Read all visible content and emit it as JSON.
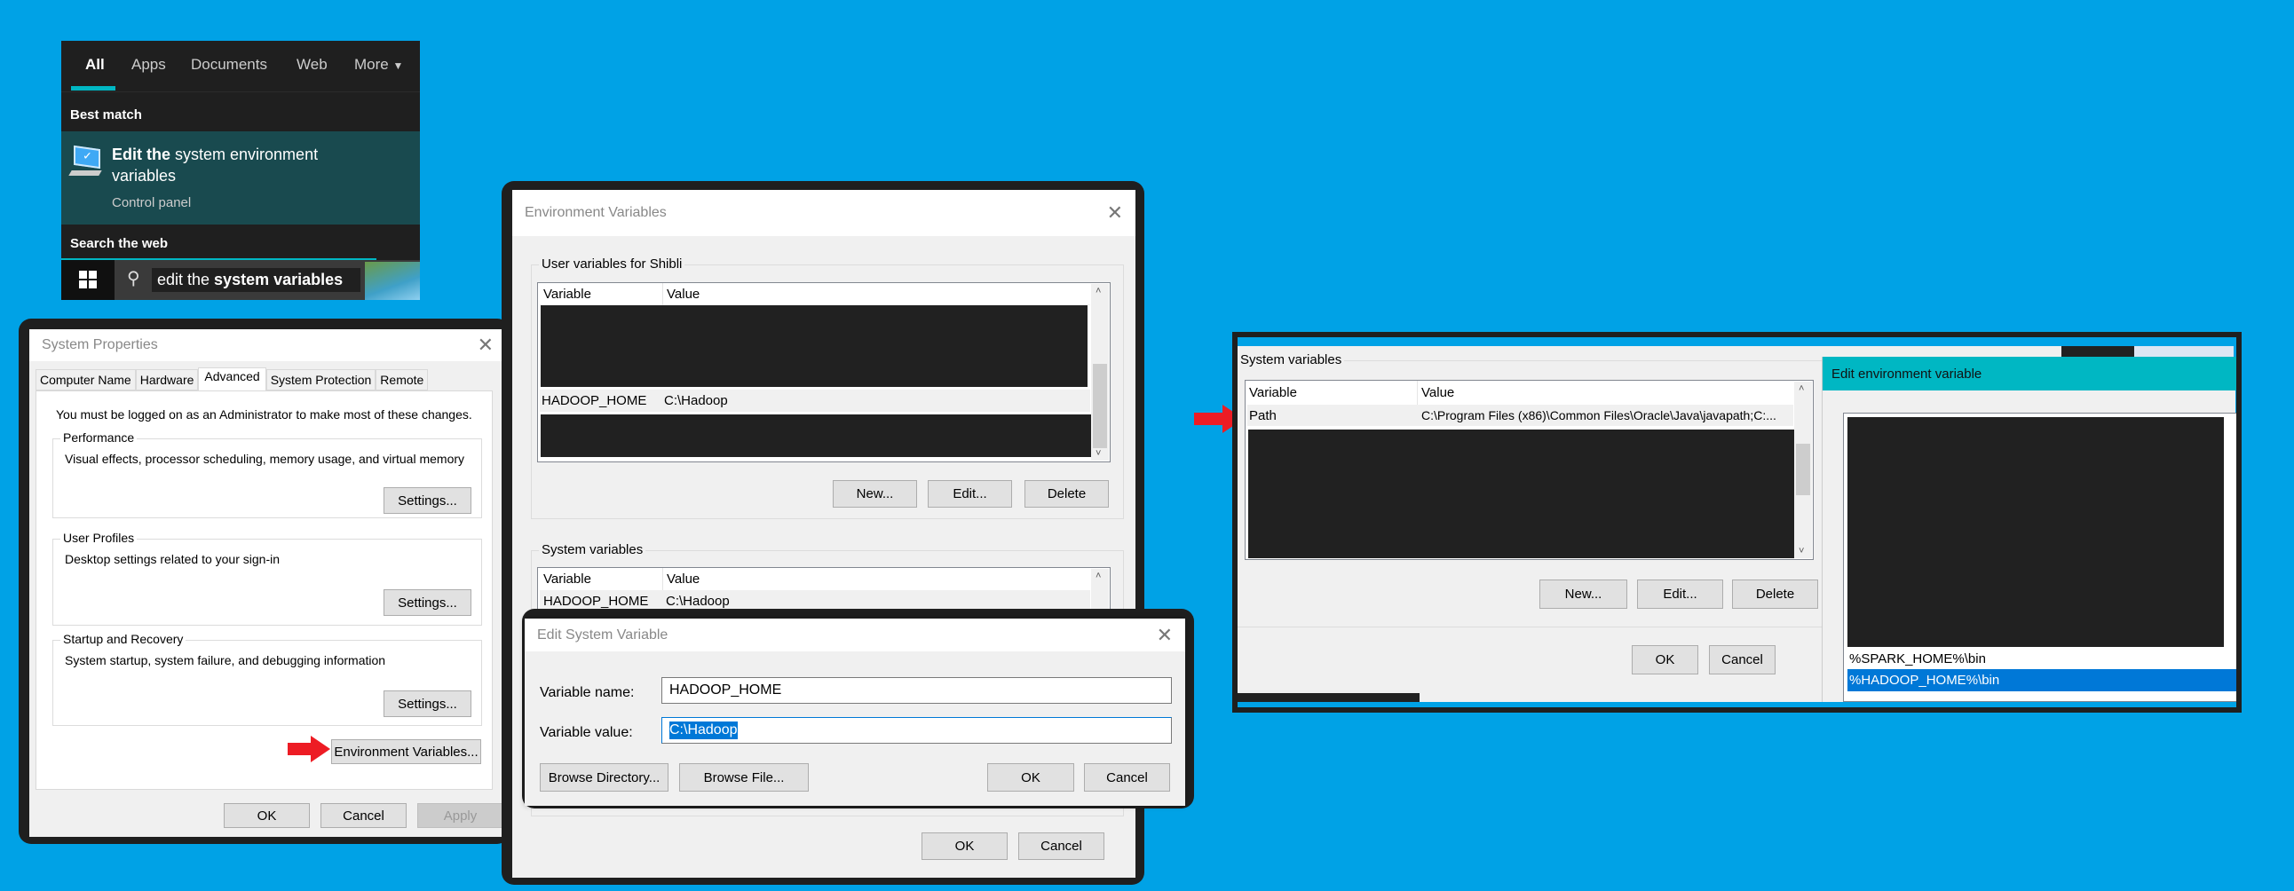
{
  "colors": {
    "desktop": "#00a2e6",
    "accent_teal": "#00b7c3",
    "selection": "#0078d7",
    "start_bg": "#1f1f1f",
    "best_match_bg": "#194a4f",
    "redaction": "#212121",
    "pointer_arrow": "#ed1c24"
  },
  "start_menu": {
    "tabs": [
      {
        "label": "All",
        "active": true
      },
      {
        "label": "Apps"
      },
      {
        "label": "Documents"
      },
      {
        "label": "Web"
      },
      {
        "label": "More"
      }
    ],
    "best_match_heading": "Best match",
    "result": {
      "title_bold": "Edit the",
      "title_rest": "system environment",
      "title_line2": "variables",
      "subtitle": "Control panel",
      "icon": "monitor-check-icon"
    },
    "search_web_heading": "Search the web",
    "taskbar": {
      "search_text_normal": "edit the ",
      "search_text_bold": "system variables",
      "start_icon": "windows-logo-icon",
      "search_icon": "magnifier-icon"
    }
  },
  "system_properties": {
    "title": "System Properties",
    "tabs": [
      {
        "label": "Computer Name"
      },
      {
        "label": "Hardware"
      },
      {
        "label": "Advanced",
        "active": true
      },
      {
        "label": "System Protection"
      },
      {
        "label": "Remote"
      }
    ],
    "admin_note": "You must be logged on as an Administrator to make most of these changes.",
    "groups": [
      {
        "label": "Performance",
        "description": "Visual effects, processor scheduling, memory usage, and virtual memory",
        "button": "Settings..."
      },
      {
        "label": "User Profiles",
        "description": "Desktop settings related to your sign-in",
        "button": "Settings..."
      },
      {
        "label": "Startup and Recovery",
        "description": "System startup, system failure, and debugging information",
        "button": "Settings..."
      }
    ],
    "env_button": "Environment Variables...",
    "ok": "OK",
    "cancel": "Cancel",
    "apply": "Apply"
  },
  "environment_variables": {
    "title": "Environment Variables",
    "user_group_label": "User variables for Shibli",
    "col_variable": "Variable",
    "col_value": "Value",
    "user_rows": [
      {
        "variable": "HADOOP_HOME",
        "value": "C:\\Hadoop"
      }
    ],
    "new": "New...",
    "edit": "Edit...",
    "delete": "Delete",
    "system_group_label": "System variables",
    "system_rows": [
      {
        "variable": "HADOOP_HOME",
        "value": "C:\\Hadoop"
      }
    ],
    "ok": "OK",
    "cancel": "Cancel"
  },
  "edit_system_variable": {
    "title": "Edit System Variable",
    "name_label": "Variable name:",
    "name_value": "HADOOP_HOME",
    "value_label": "Variable value:",
    "value_value": "C:\\Hadoop",
    "browse_directory": "Browse Directory...",
    "browse_file": "Browse File...",
    "ok": "OK",
    "cancel": "Cancel"
  },
  "path_panel": {
    "system_group_label": "System variables",
    "col_variable": "Variable",
    "col_value": "Value",
    "path_row": {
      "variable": "Path",
      "value": "C:\\Program Files (x86)\\Common Files\\Oracle\\Java\\javapath;C:..."
    },
    "new": "New...",
    "edit": "Edit...",
    "delete": "Delete",
    "ok": "OK",
    "cancel": "Cancel"
  },
  "edit_env_variable": {
    "title": "Edit environment variable",
    "entries": [
      {
        "text": "%SPARK_HOME%\\bin"
      },
      {
        "text": "%HADOOP_HOME%\\bin",
        "selected": true
      }
    ]
  }
}
